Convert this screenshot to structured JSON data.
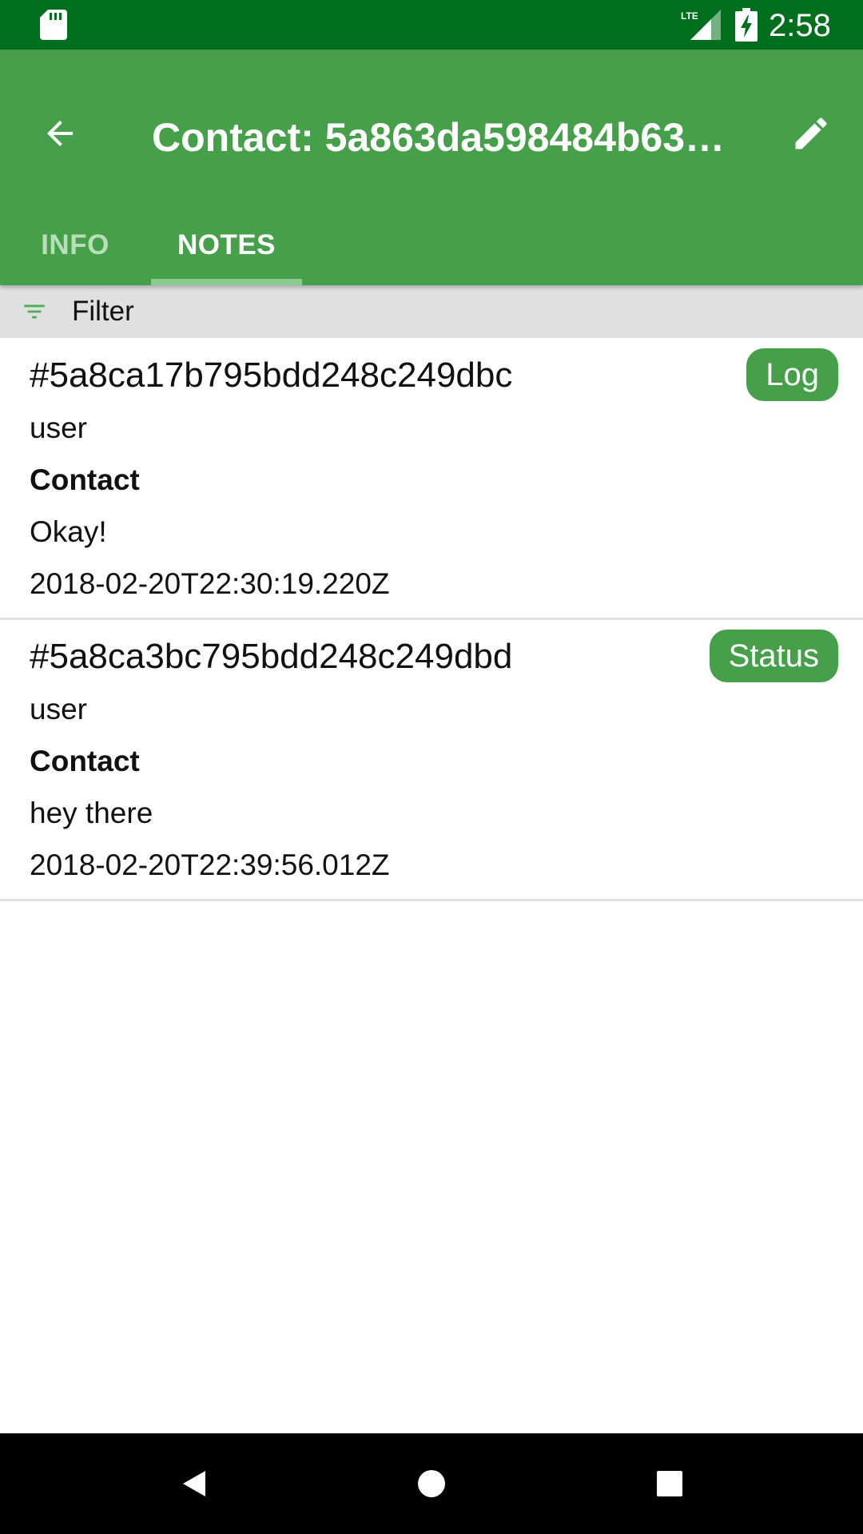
{
  "status_bar": {
    "time": "2:58",
    "network": "LTE",
    "icons": [
      "sd-card-icon",
      "lte-signal-icon",
      "battery-charging-icon"
    ]
  },
  "toolbar": {
    "title": "Contact: 5a863da598484b63…",
    "back_icon": "arrow-back-icon",
    "edit_icon": "edit-pencil-icon",
    "background_color": "#46a04a",
    "status_bar_color": "#006f1d"
  },
  "tabs": [
    {
      "label": "INFO",
      "selected": false
    },
    {
      "label": "NOTES",
      "selected": true
    }
  ],
  "filter": {
    "label": "Filter",
    "icon": "filter-icon"
  },
  "notes": [
    {
      "id": "#5a8ca17b795bdd248c249dbc",
      "user": "user",
      "subject": "Contact",
      "text": "Okay!",
      "timestamp": "2018-02-20T22:30:19.220Z",
      "badge": "Log"
    },
    {
      "id": "#5a8ca3bc795bdd248c249dbd",
      "user": "user",
      "subject": "Contact",
      "text": "hey there",
      "timestamp": "2018-02-20T22:39:56.012Z",
      "badge": "Status"
    }
  ],
  "nav_bar": {
    "icons": [
      "nav-back-icon",
      "nav-home-icon",
      "nav-recents-icon"
    ]
  }
}
